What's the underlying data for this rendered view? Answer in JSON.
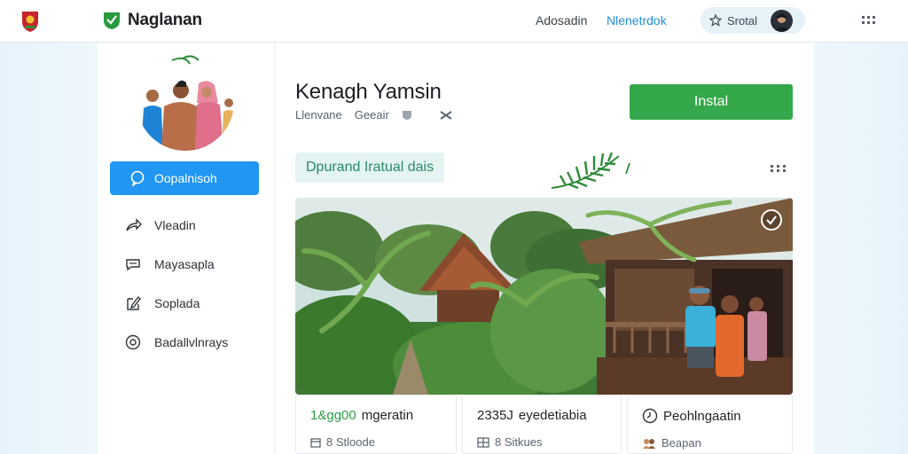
{
  "header": {
    "brand": "Naglanan",
    "nav": [
      "Adosadin",
      "Nlenetrdok"
    ],
    "search_label": "Srotal"
  },
  "colors": {
    "primary": "#2196f3",
    "install": "#34a84a",
    "accent_link": "#1f8dd6",
    "chip_bg": "#e4f4f2"
  },
  "sidebar": {
    "primary_label": "Oopalnisoh",
    "items": [
      {
        "icon": "share-icon",
        "label": "Vleadin"
      },
      {
        "icon": "chat-icon",
        "label": "Mayasapla"
      },
      {
        "icon": "edit-icon",
        "label": "Soplada"
      },
      {
        "icon": "circle-icon",
        "label": "Badallvlnrays"
      }
    ]
  },
  "main": {
    "title": "Kenagh Yamsin",
    "meta": [
      "Llenvane",
      "Geeair"
    ],
    "install_label": "Instal",
    "chip": "Dpurand Iratual  dais"
  },
  "stats": [
    {
      "value": "1&gg00",
      "label": "mgeratin",
      "sub": "8 Stloode",
      "icon": "calendar-icon"
    },
    {
      "value": "2335J",
      "label": "eyedetiabia",
      "sub": "8 Sitkues",
      "icon": "grid-icon"
    },
    {
      "value": "",
      "label": "Peohlngaatin",
      "sub": "Beapan",
      "icon": "clock-icon"
    }
  ]
}
